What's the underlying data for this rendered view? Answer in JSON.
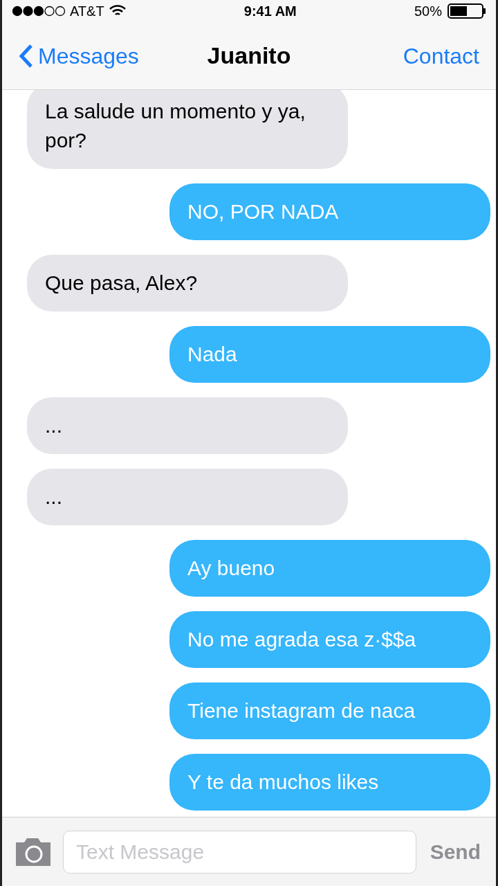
{
  "status_bar": {
    "carrier": "AT&T",
    "time": "9:41 AM",
    "battery": "50%"
  },
  "nav": {
    "back": "Messages",
    "title": "Juanito",
    "action": "Contact"
  },
  "messages": [
    {
      "kind": "received",
      "text": "La salude un momento y ya, por?"
    },
    {
      "kind": "sent",
      "text": "NO, POR NADA"
    },
    {
      "kind": "received",
      "text": "Que pasa, Alex?"
    },
    {
      "kind": "sent",
      "text": "Nada"
    },
    {
      "kind": "received",
      "text": "..."
    },
    {
      "kind": "received",
      "text": "..."
    },
    {
      "kind": "sent",
      "text": "Ay bueno"
    },
    {
      "kind": "sent",
      "text": "No me agrada esa z·$$a"
    },
    {
      "kind": "sent",
      "text": "Tiene instagram de naca"
    },
    {
      "kind": "sent",
      "text": "Y te da muchos likes"
    }
  ],
  "composer": {
    "placeholder": "Text Message",
    "send": "Send"
  }
}
